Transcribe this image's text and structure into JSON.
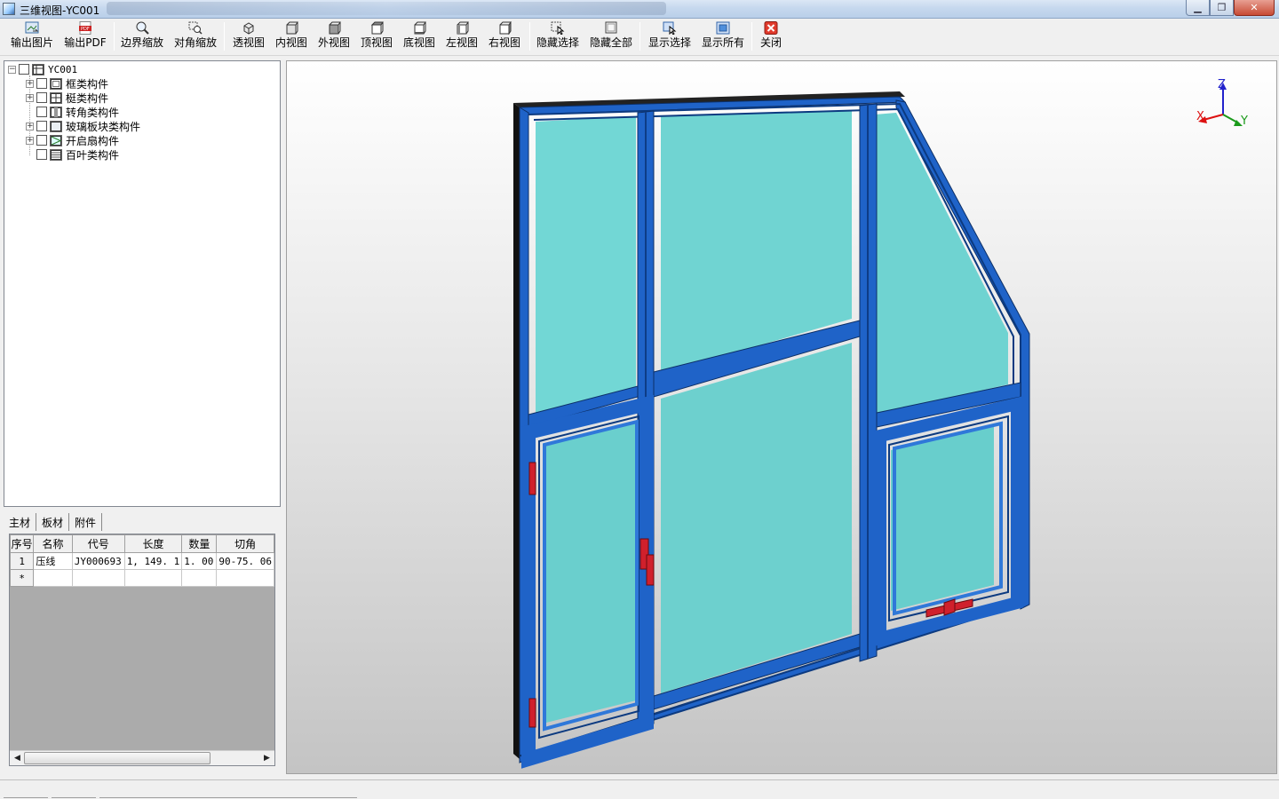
{
  "window": {
    "title": "三维视图-YC001",
    "controls": [
      "minimize",
      "maximize",
      "close"
    ]
  },
  "toolbar": {
    "buttons": [
      {
        "label": "输出图片",
        "icon": "export-image-icon"
      },
      {
        "label": "输出PDF",
        "icon": "pdf-icon"
      },
      {
        "label": "边界缩放",
        "icon": "zoom-extents-icon"
      },
      {
        "label": "对角缩放",
        "icon": "zoom-window-icon"
      },
      {
        "label": "透视图",
        "icon": "perspective-icon"
      },
      {
        "label": "内视图",
        "icon": "inner-view-icon"
      },
      {
        "label": "外视图",
        "icon": "outer-view-icon"
      },
      {
        "label": "顶视图",
        "icon": "top-view-icon"
      },
      {
        "label": "底视图",
        "icon": "bottom-view-icon"
      },
      {
        "label": "左视图",
        "icon": "left-view-icon"
      },
      {
        "label": "右视图",
        "icon": "right-view-icon"
      },
      {
        "label": "隐藏选择",
        "icon": "hide-selection-icon"
      },
      {
        "label": "隐藏全部",
        "icon": "hide-all-icon"
      },
      {
        "label": "显示选择",
        "icon": "show-selection-icon"
      },
      {
        "label": "显示所有",
        "icon": "show-all-icon"
      },
      {
        "label": "关闭",
        "icon": "close-icon"
      }
    ]
  },
  "tree": {
    "root": {
      "label": "YC001",
      "expanded": true
    },
    "children": [
      {
        "label": "框类构件",
        "expandable": true
      },
      {
        "label": "梃类构件",
        "expandable": true
      },
      {
        "label": "转角类构件",
        "expandable": false
      },
      {
        "label": "玻璃板块类构件",
        "expandable": true
      },
      {
        "label": "开启扇构件",
        "expandable": true
      },
      {
        "label": "百叶类构件",
        "expandable": false
      }
    ]
  },
  "tabs": [
    {
      "label": "主材",
      "active": true
    },
    {
      "label": "板材",
      "active": false
    },
    {
      "label": "附件",
      "active": false
    }
  ],
  "grid": {
    "columns": [
      "序号",
      "名称",
      "代号",
      "长度",
      "数量",
      "切角"
    ],
    "rows": [
      [
        "1",
        "压线",
        "JY000693",
        "1, 149. 1",
        "1. 00",
        "90-75. 06"
      ]
    ],
    "new_row_marker": "*"
  },
  "viewport": {
    "axis_labels": {
      "z": "Z",
      "x": "X",
      "y": "Y"
    },
    "colors": {
      "frame": "#1f63c8",
      "frame_dark": "#103a7a",
      "glass": "#6fd4d2",
      "hardware": "#d0202c",
      "axis_x": "#d11",
      "axis_y": "#1a9a1a",
      "axis_z": "#2222cc"
    }
  }
}
